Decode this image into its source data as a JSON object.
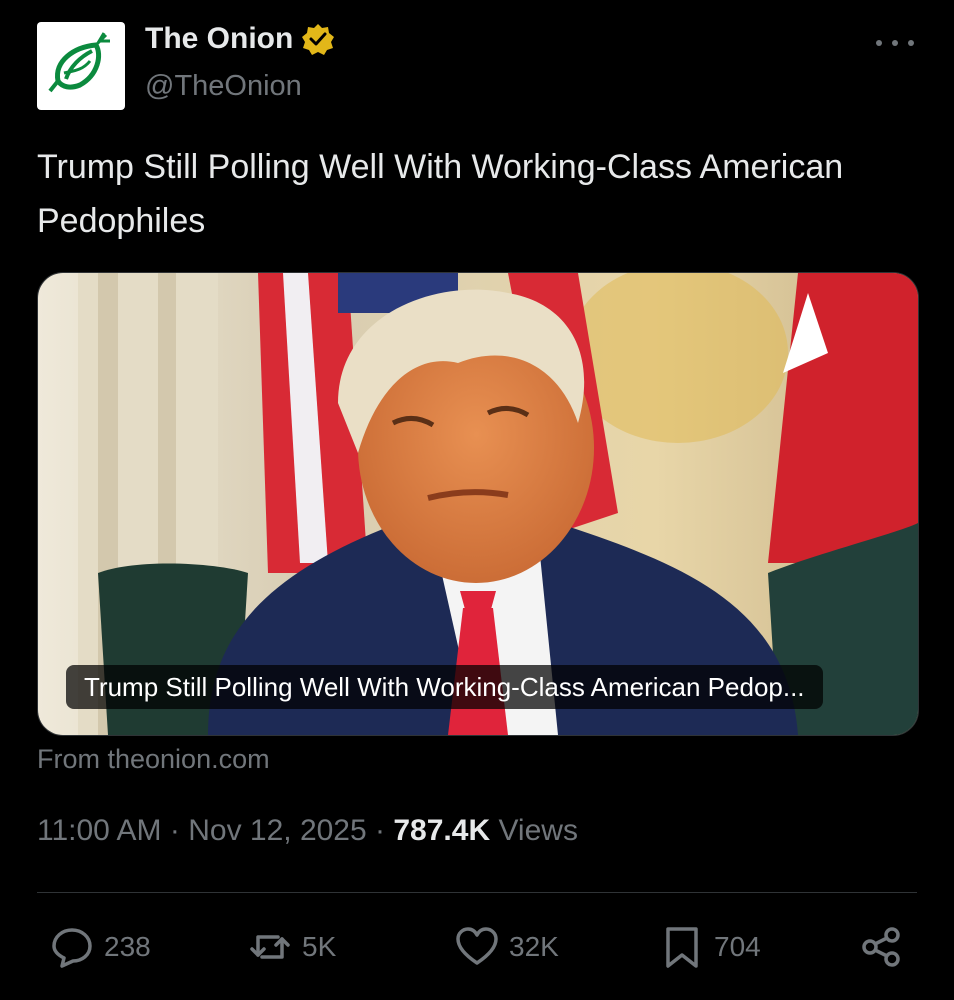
{
  "account": {
    "display_name": "The Onion",
    "handle": "@TheOnion",
    "avatar_icon": "onion-logo-icon",
    "verified_icon": "verified-badge-icon",
    "verified_color": "#e2b719",
    "brand_color": "#0b8a3e"
  },
  "tweet": {
    "text": "Trump Still Polling Well With Working-Class American Pedophiles"
  },
  "card": {
    "caption": "Trump Still Polling Well With Working-Class American Pedop...",
    "source": "From theonion.com"
  },
  "meta": {
    "time": "11:00 AM",
    "separator": "·",
    "date": "Nov 12, 2025",
    "views_count": "787.4K",
    "views_label": "Views"
  },
  "actions": {
    "replies": "238",
    "reposts": "5K",
    "likes": "32K",
    "bookmarks": "704"
  },
  "icons": {
    "more": "more-dots-icon",
    "reply": "reply-icon",
    "repost": "repost-icon",
    "like": "heart-icon",
    "bookmark": "bookmark-icon",
    "share": "share-icon"
  }
}
